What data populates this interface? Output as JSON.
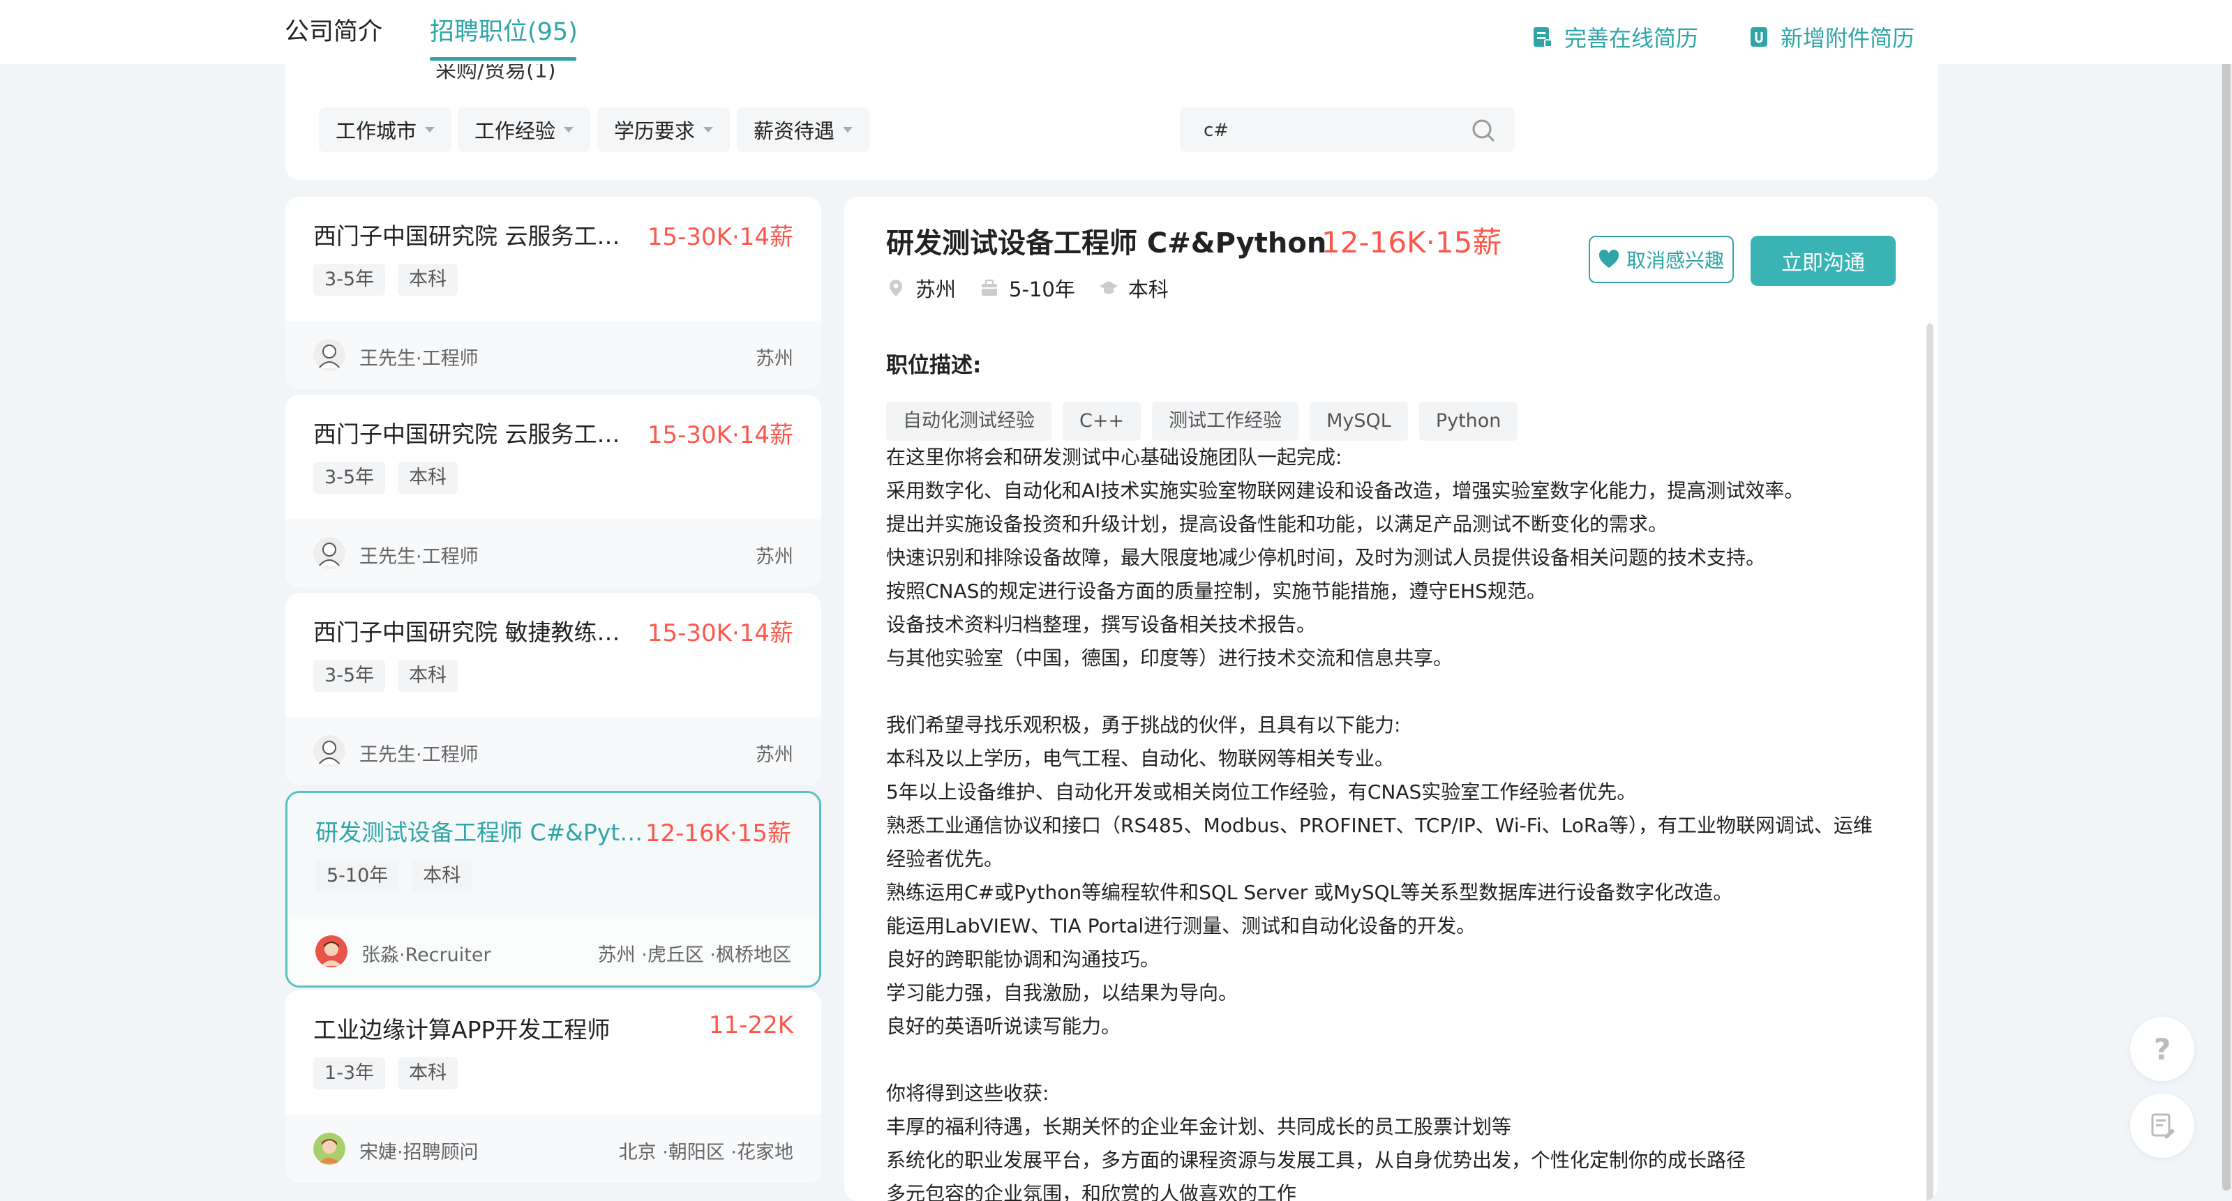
{
  "header": {
    "tabs": [
      {
        "label": "公司简介"
      },
      {
        "label": "招聘职位(95)"
      }
    ],
    "stub_text": "采购/贸易(1)",
    "actions": [
      {
        "label": "完善在线简历",
        "icon": "resume-edit-icon"
      },
      {
        "label": "新增附件简历",
        "icon": "attachment-icon"
      }
    ]
  },
  "filters": {
    "items": [
      {
        "label": "工作城市"
      },
      {
        "label": "工作经验"
      },
      {
        "label": "学历要求"
      },
      {
        "label": "薪资待遇"
      }
    ],
    "search": {
      "value": "c#",
      "placeholder": ""
    }
  },
  "jobs": [
    {
      "title": "西门子中国研究院 云服务工程师",
      "salary": "15-30K·14薪",
      "tags": [
        "3-5年",
        "本科"
      ],
      "recruiter": "王先生·工程师",
      "city": "苏州"
    },
    {
      "title": "西门子中国研究院 云服务工程师",
      "salary": "15-30K·14薪",
      "tags": [
        "3-5年",
        "本科"
      ],
      "recruiter": "王先生·工程师",
      "city": "苏州"
    },
    {
      "title": "西门子中国研究院 敏捷教练（...",
      "salary": "15-30K·14薪",
      "tags": [
        "3-5年",
        "本科"
      ],
      "recruiter": "王先生·工程师",
      "city": "苏州"
    },
    {
      "title": "研发测试设备工程师 C#&Python",
      "salary": "12-16K·15薪",
      "tags": [
        "5-10年",
        "本科"
      ],
      "recruiter": "张淼·Recruiter",
      "city": "苏州 ·虎丘区 ·枫桥地区"
    },
    {
      "title": "工业边缘计算APP开发工程师",
      "salary": "11-22K",
      "tags": [
        "1-3年",
        "本科"
      ],
      "recruiter": "宋婕·招聘顾问",
      "city": "北京 ·朝阳区 ·花家地"
    }
  ],
  "detail": {
    "title": "研发测试设备工程师 C#&Python",
    "salary": "12-16K·15薪",
    "meta": {
      "city": "苏州",
      "experience": "5-10年",
      "education": "本科"
    },
    "fav_label": "取消感兴趣",
    "chat_label": "立即沟通",
    "section_title": "职位描述:",
    "skills": [
      "自动化测试经验",
      "C++",
      "测试工作经验",
      "MySQL",
      "Python"
    ],
    "lines": [
      "在这里你将会和研发测试中心基础设施团队一起完成:",
      "采用数字化、自动化和AI技术实施实验室物联网建设和设备改造，增强实验室数字化能力，提高测试效率。",
      "提出并实施设备投资和升级计划，提高设备性能和功能，以满足产品测试不断变化的需求。",
      "快速识别和排除设备故障，最大限度地减少停机时间，及时为测试人员提供设备相关问题的技术支持。",
      "按照CNAS的规定进行设备方面的质量控制，实施节能措施，遵守EHS规范。",
      "设备技术资料归档整理，撰写设备相关技术报告。",
      "与其他实验室（中国，德国，印度等）进行技术交流和信息共享。",
      "",
      "我们希望寻找乐观积极，勇于挑战的伙伴，且具有以下能力:",
      "本科及以上学历，电气工程、自动化、物联网等相关专业。",
      "5年以上设备维护、自动化开发或相关岗位工作经验，有CNAS实验室工作经验者优先。",
      "熟悉工业通信协议和接口（RS485、Modbus、PROFINET、TCP/IP、Wi-Fi、LoRa等），有工业物联网调试、运维",
      "经验者优先。",
      "熟练运用C#或Python等编程软件和SQL Server 或MySQL等关系型数据库进行设备数字化改造。",
      "能运用LabVIEW、TIA Portal进行测量、测试和自动化设备的开发。",
      "良好的跨职能协调和沟通技巧。",
      "学习能力强，自我激励，以结果为导向。",
      "良好的英语听说读写能力。",
      "",
      "你将得到这些收获:",
      "丰厚的福利待遇，长期关怀的企业年金计划、共同成长的员工股票计划等",
      "系统化的职业发展平台，多方面的课程资源与发展工具，从自身优势出发，个性化定制你的成长路径",
      "多元包容的企业氛围，和欣赏的人做喜欢的工作"
    ]
  },
  "float": {
    "help_symbol": "?"
  },
  "colors": {
    "accent": "#2fa5a8",
    "salary": "#fe574a"
  }
}
